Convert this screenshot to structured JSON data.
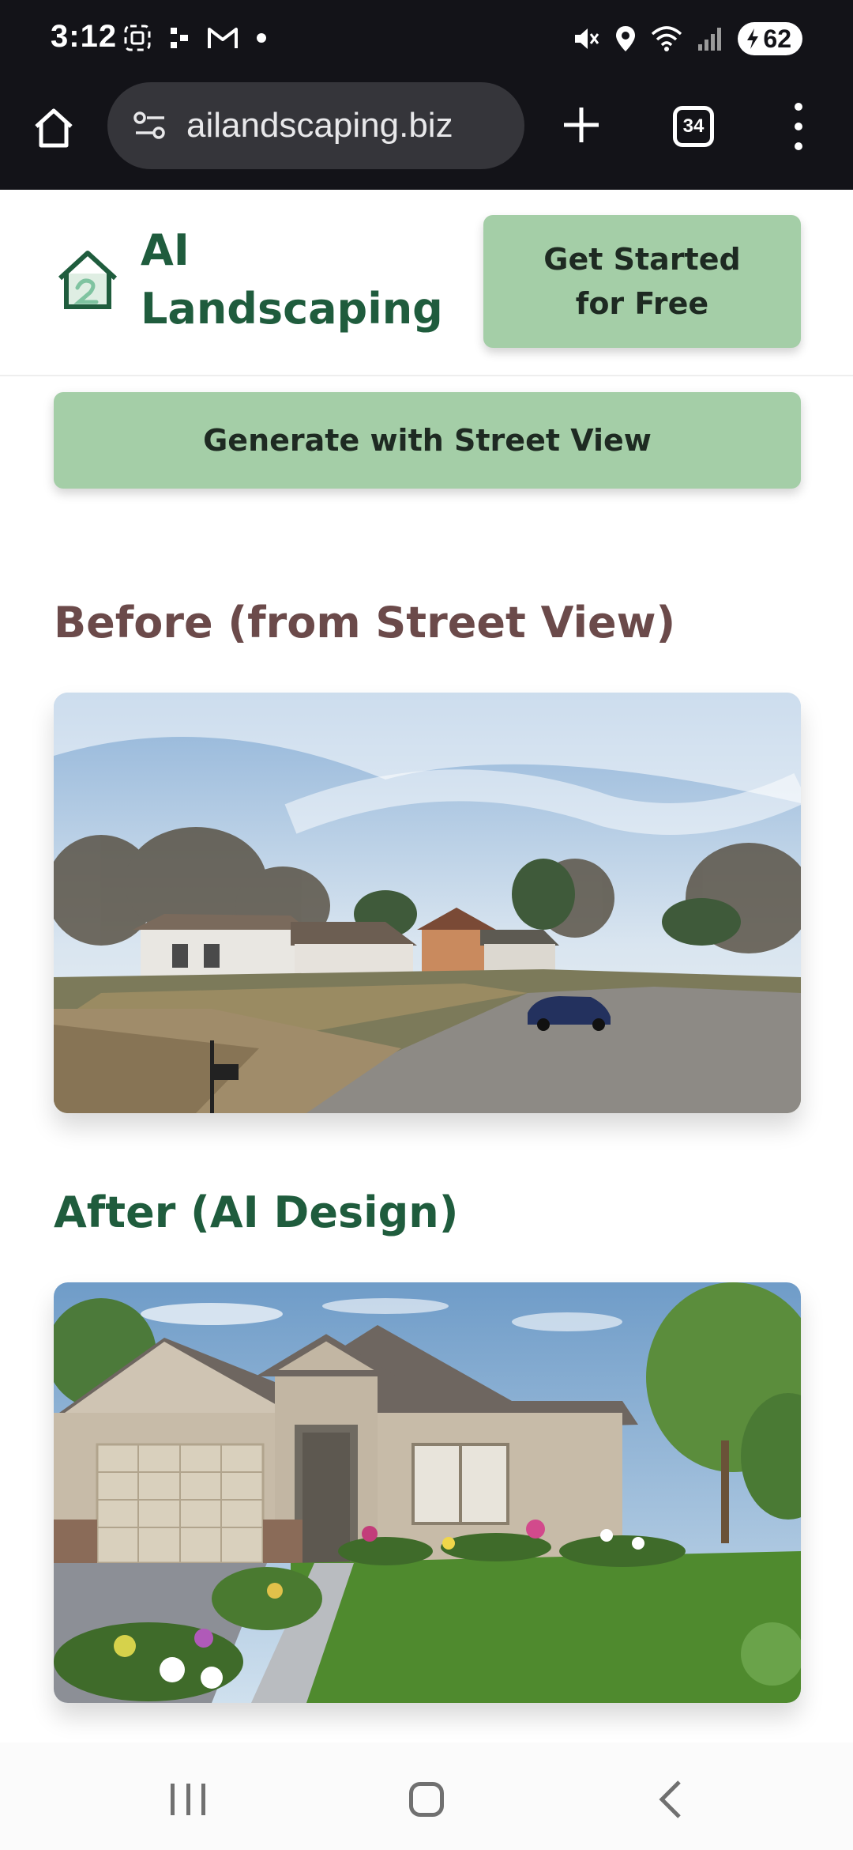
{
  "status_bar": {
    "time": "3:12",
    "battery": "62",
    "icons": [
      "screenshot-icon",
      "dots-icon",
      "gmail-icon",
      "notification-dot-icon",
      "mute-icon",
      "location-icon",
      "wifi-icon",
      "signal-icon",
      "battery-icon"
    ]
  },
  "browser": {
    "url": "ailandscaping.biz",
    "tab_count": "34"
  },
  "header": {
    "logo_line1": "AI",
    "logo_line2": "Landscaping",
    "cta_label": "Get Started for Free"
  },
  "main": {
    "street_view_button": "Generate with Street View",
    "before_title": "Before (from Street View)",
    "after_title": "After (AI Design)"
  },
  "colors": {
    "brand_green": "#1f5c3d",
    "button_green": "#a4cea7",
    "before_title": "#6b4a4a",
    "browser_dark": "#131318"
  }
}
